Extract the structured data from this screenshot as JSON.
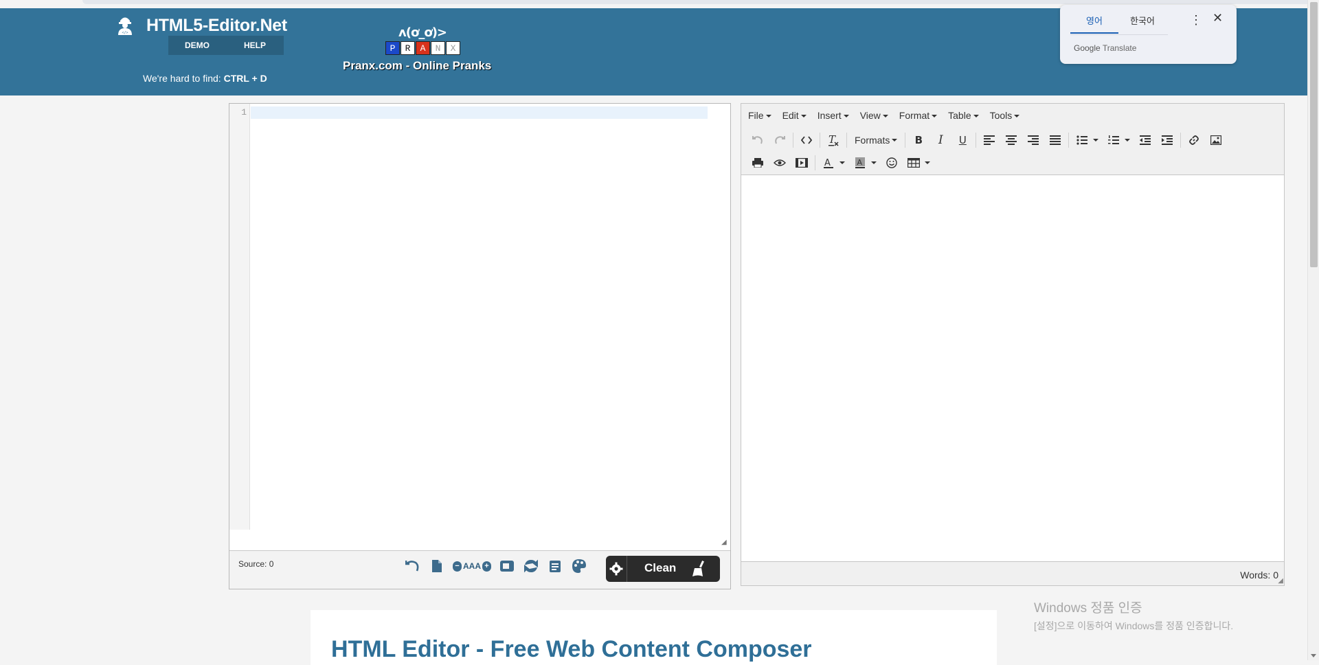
{
  "header": {
    "site_title": "HTML5-Editor.Net",
    "nav": [
      {
        "label": "DEMO"
      },
      {
        "label": "HELP"
      }
    ],
    "hard_find_prefix": "We're hard to find:",
    "hard_find_keys": "CTRL + D",
    "pranx_face": "ʌ(ơ_ơ)>",
    "pranx_tiles": [
      "P",
      "R",
      "A",
      "N",
      "X"
    ],
    "pranx_caption": "Pranx.com - Online Pranks"
  },
  "translate_popup": {
    "tabs": [
      {
        "label": "영어",
        "active": true
      },
      {
        "label": "한국어",
        "active": false
      }
    ],
    "brand_google": "Google",
    "brand_translate": "Translate"
  },
  "source_editor": {
    "line_number": "1",
    "source_label": "Source: 0",
    "font_label": "AAA",
    "clean_label": "Clean"
  },
  "wysiwyg": {
    "menu": [
      "File",
      "Edit",
      "Insert",
      "View",
      "Format",
      "Table",
      "Tools"
    ],
    "formats_label": "Formats",
    "words_label": "Words: 0"
  },
  "article": {
    "title": "HTML Editor - Free Web Content Composer"
  },
  "watermark": {
    "line1": "Windows 정품 인증",
    "line2": "[설정]으로 이동하여 Windows를 정품 인증합니다."
  },
  "colors": {
    "header_bg": "#337399",
    "nav_bg": "#2a607f",
    "title_blue": "#2f6f97",
    "clean_btn_bg": "#2b2b2b",
    "pranx_p": "#1b49c9",
    "pranx_a": "#d8321c"
  }
}
